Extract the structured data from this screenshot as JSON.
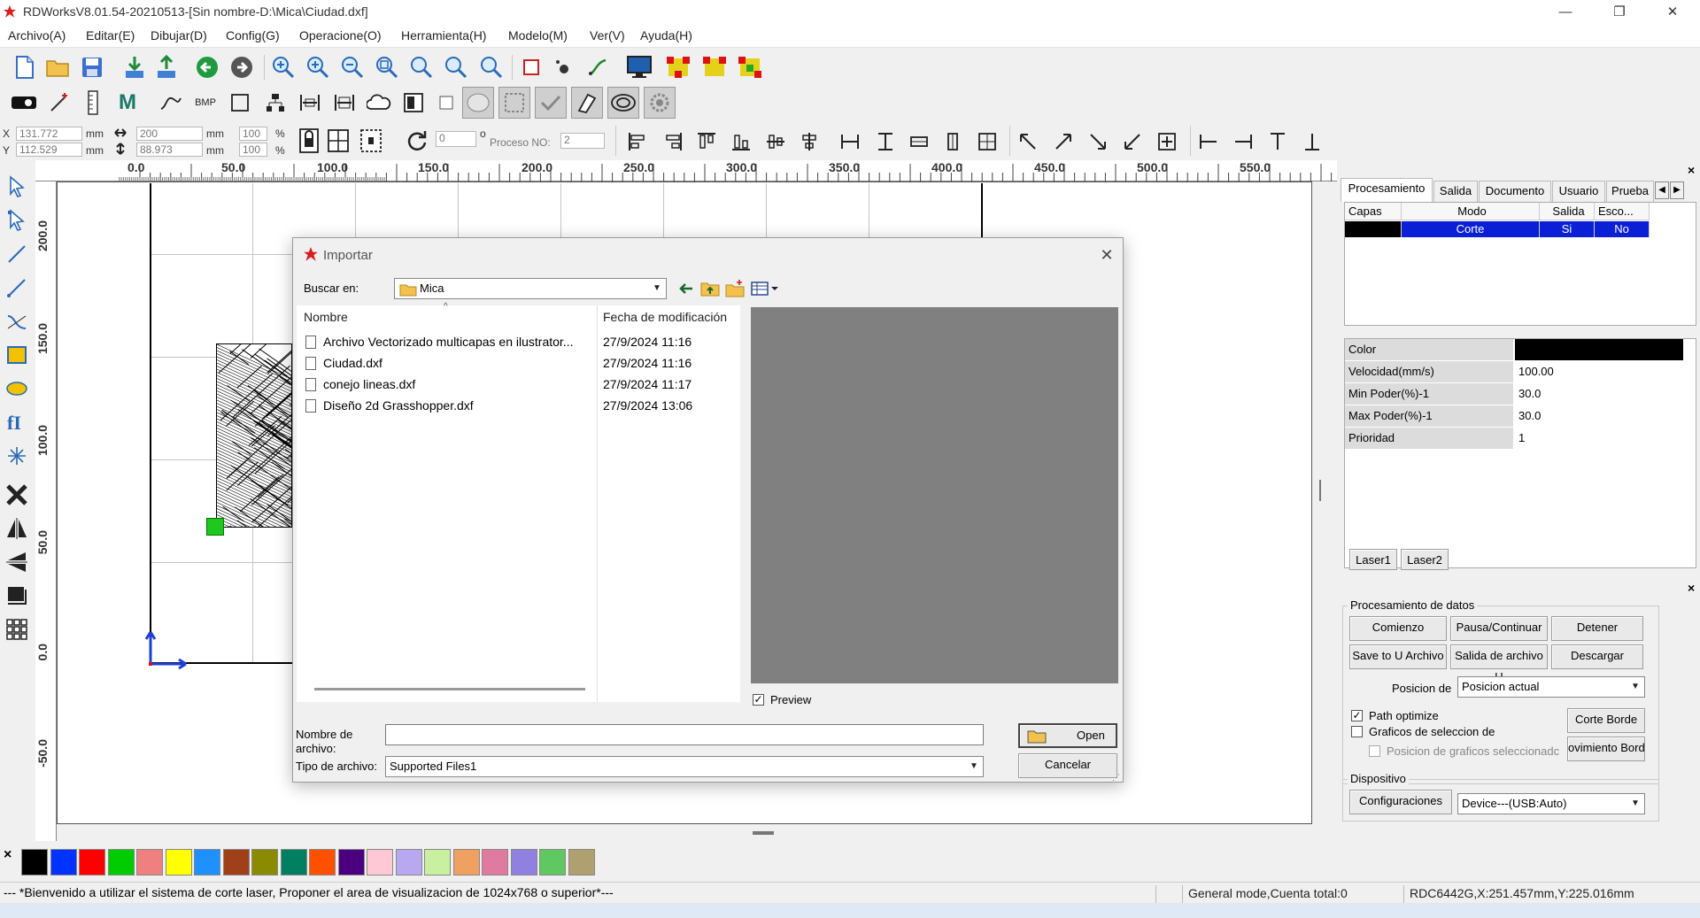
{
  "window": {
    "title": "RDWorksV8.01.54-20210513-[Sin nombre-D:\\Mica\\Ciudad.dxf]",
    "minimize": "—",
    "maximize": "❐",
    "close": "✕"
  },
  "menu": [
    "Archivo(A)",
    "Editar(E)",
    "Dibujar(D)",
    "Config(G)",
    "Operacione(O)",
    "Herramienta(H)",
    "Modelo(M)",
    "Ver(V)",
    "Ayuda(H)"
  ],
  "coords": {
    "x_label": "X",
    "y_label": "Y",
    "x_value": "131.772",
    "y_value": "112.529",
    "unit": "mm",
    "width_value": "200",
    "height_value": "88.973",
    "scale_x": "100",
    "scale_y": "100",
    "percent": "%",
    "rotate_value": "0",
    "degree": "o",
    "process_label": "Proceso NO:",
    "process_value": "2"
  },
  "ruler": {
    "h_labels": [
      "0.0",
      "50.0",
      "100.0",
      "150.0",
      "200.0",
      "250.0",
      "300.0",
      "350.0",
      "400.0",
      "450.0",
      "500.0",
      "550.0"
    ],
    "v_labels": [
      "200.0",
      "150.0",
      "100.0",
      "50.0",
      "0.0",
      "-50.0"
    ]
  },
  "palette": {
    "close_label": "×",
    "colors": [
      "#000000",
      "#0033ff",
      "#ff0000",
      "#00cc00",
      "#f08080",
      "#ffff00",
      "#1e90ff",
      "#a0401a",
      "#8b8b00",
      "#008060",
      "#ff5000",
      "#4b0080",
      "#ffc8d4",
      "#b8a8f0",
      "#c8f0a0",
      "#f0a060",
      "#e07aa0",
      "#9080e0",
      "#60c860",
      "#b0a070"
    ]
  },
  "status": {
    "message": "--- *Bienvenido a utilizar el sistema de corte laser, Proponer el area de visualizacion de 1024x768 o superior*---",
    "mode": "General mode,Cuenta total:0",
    "device_pos": "RDC6442G,X:251.457mm,Y:225.016mm"
  },
  "right_panel": {
    "close": "×",
    "tabs": [
      "Procesamiento",
      "Salida",
      "Documento",
      "Usuario",
      "Prueba"
    ],
    "layer_headers": [
      "Capas",
      "Modo",
      "Salida",
      "Esco..."
    ],
    "layer_row": {
      "color": "#000000",
      "mode": "Corte",
      "output": "Si",
      "hide": "No"
    },
    "properties": [
      {
        "name": "Color",
        "value": ""
      },
      {
        "name": "Velocidad(mm/s)",
        "value": "100.00"
      },
      {
        "name": "Min Poder(%)-1",
        "value": "30.0"
      },
      {
        "name": "Max Poder(%)-1",
        "value": "30.0"
      },
      {
        "name": "Prioridad",
        "value": "1"
      }
    ],
    "laser_tabs": [
      "Laser1",
      "Laser2"
    ]
  },
  "data_panel": {
    "close": "×",
    "group_title": "Procesamiento de datos",
    "start": "Comienzo",
    "pause": "Pausa/Continuar",
    "stop": "Detener",
    "save_u": "Save to U Archivo",
    "output_u": "Salida de archivo U",
    "download": "Descargar",
    "position_label": "Posicion de",
    "position_value": "Posicion actual",
    "path_optimize": "Path optimize",
    "selection_graphics": "Graficos de seleccion de",
    "selection_position": "Posicion de graficos seleccionadc",
    "border_cut": "Corte Borde",
    "border_move": "ovimiento Bord",
    "device_title": "Dispositivo",
    "config_button": "Configuraciones",
    "device_value": "Device---(USB:Auto)"
  },
  "dialog": {
    "title": "Importar",
    "look_in_label": "Buscar en:",
    "look_in_value": "Mica",
    "col_name": "Nombre",
    "col_date": "Fecha de modificación",
    "files": [
      {
        "name": "Archivo Vectorizado multicapas en ilustrator...",
        "date": "27/9/2024 11:16"
      },
      {
        "name": "Ciudad.dxf",
        "date": "27/9/2024 11:16"
      },
      {
        "name": "conejo lineas.dxf",
        "date": "27/9/2024 11:17"
      },
      {
        "name": "Diseño 2d Grasshopper.dxf",
        "date": "27/9/2024 13:06"
      }
    ],
    "preview_label": "Preview",
    "filename_label_1": "Nombre de",
    "filename_label_2": "archivo:",
    "filename_value": "",
    "filetype_label": "Tipo de archivo:",
    "filetype_value": "Supported Files1",
    "open_button": "Open",
    "cancel_button": "Cancelar"
  }
}
